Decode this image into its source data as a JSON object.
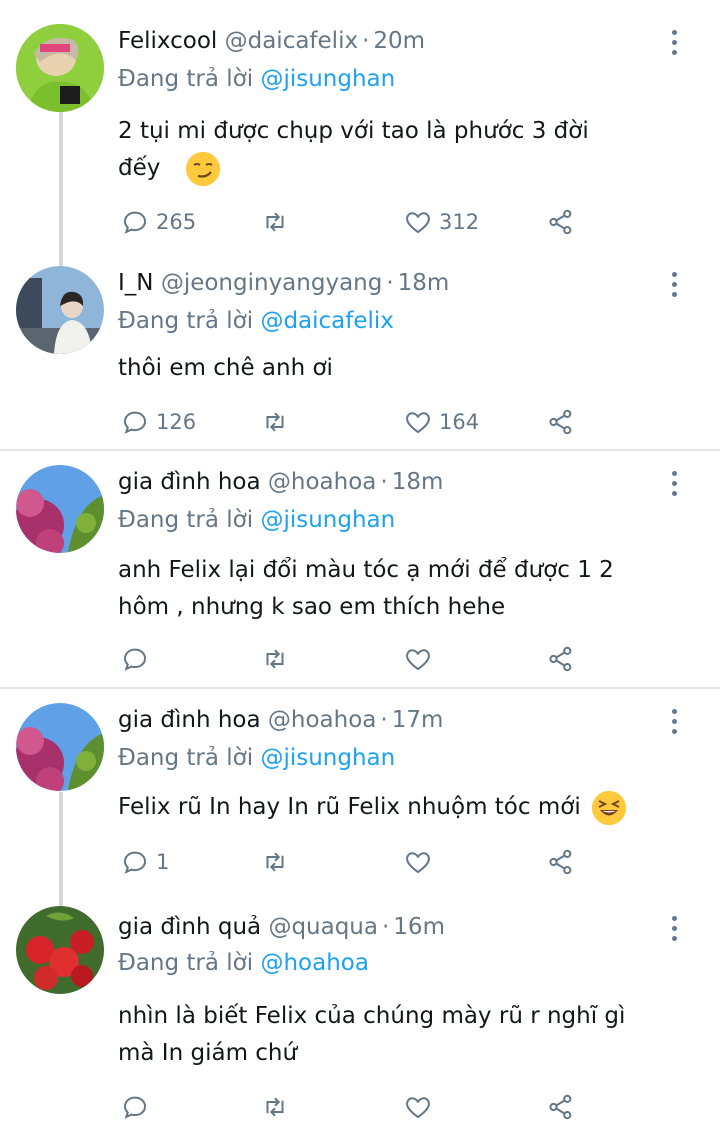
{
  "replying_prefix": "Đang trả lời ",
  "colors": {
    "mention": "#1da1f2",
    "secondary": "#657786",
    "divider": "#e3e6e8"
  },
  "tweets": [
    {
      "name": "Felixcool",
      "handle": "@daicafelix",
      "time": "20m",
      "replying_to": "@jisunghan",
      "text_lines": [
        "2 tụi mi được chụp với tao là phước 3 đời",
        "đếy"
      ],
      "emoji": "smirk-emoji",
      "replies": "265",
      "retweets": "",
      "likes": "312"
    },
    {
      "name": "I_N",
      "handle": "@jeonginyangyang",
      "time": "18m",
      "replying_to": "@daicafelix",
      "text_lines": [
        "thôi em chê anh ơi"
      ],
      "replies": "126",
      "retweets": "",
      "likes": "164"
    },
    {
      "name": "gia đình hoa",
      "handle": "@hoahoa",
      "time": "18m",
      "replying_to": "@jisunghan",
      "text_lines": [
        "anh Felix lại đổi màu tóc ạ mới để được 1 2",
        "hôm ,  nhưng k sao em thích hehe"
      ],
      "replies": "",
      "retweets": "",
      "likes": ""
    },
    {
      "name": "gia đình hoa",
      "handle": "@hoahoa",
      "time": "17m",
      "replying_to": "@jisunghan",
      "text_lines": [
        "Felix rũ In hay In rũ Felix nhuộm tóc mới"
      ],
      "emoji": "laughing-emoji",
      "replies": "1",
      "retweets": "",
      "likes": ""
    },
    {
      "name": "gia đình quả",
      "handle": "@quaqua",
      "time": "16m",
      "replying_to": "@hoahoa",
      "text_lines": [
        "nhìn là biết Felix của chúng mày rũ r nghĩ gì",
        "mà In giám chứ"
      ],
      "replies": "",
      "retweets": "",
      "likes": ""
    }
  ]
}
